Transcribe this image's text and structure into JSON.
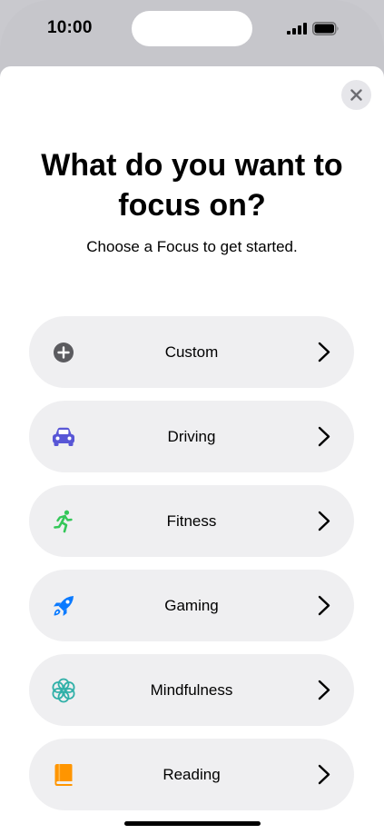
{
  "status_bar": {
    "time": "10:00"
  },
  "sheet": {
    "title": "What do you want to focus on?",
    "subtitle": "Choose a Focus to get started."
  },
  "options": [
    {
      "label": "Custom",
      "icon": "plus-circle-icon",
      "color": "#5b5b5f"
    },
    {
      "label": "Driving",
      "icon": "car-icon",
      "color": "#5856d6"
    },
    {
      "label": "Fitness",
      "icon": "running-figure-icon",
      "color": "#34c759"
    },
    {
      "label": "Gaming",
      "icon": "rocket-icon",
      "color": "#0a7aff"
    },
    {
      "label": "Mindfulness",
      "icon": "flower-icon",
      "color": "#30b0a8"
    },
    {
      "label": "Reading",
      "icon": "book-icon",
      "color": "#ff9500"
    }
  ]
}
